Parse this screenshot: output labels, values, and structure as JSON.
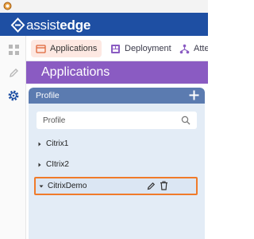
{
  "brand": {
    "name_light": "assist",
    "name_bold": "edge"
  },
  "nav": {
    "items": [
      {
        "label": "Applications",
        "active": true
      },
      {
        "label": "Deployment",
        "active": false
      },
      {
        "label": "Atten",
        "active": false
      }
    ]
  },
  "sidebar": {
    "items": [
      "grid-icon",
      "pencil-icon",
      "gear-icon"
    ],
    "active": "gear-icon"
  },
  "page": {
    "title": "Applications"
  },
  "profile_panel": {
    "title": "Profile",
    "search": {
      "placeholder": "Profile",
      "value": ""
    },
    "items": [
      {
        "label": "Citrix1",
        "expanded": false,
        "selected": false
      },
      {
        "label": "CItrix2",
        "expanded": false,
        "selected": false
      },
      {
        "label": "CitrixDemo",
        "expanded": true,
        "selected": true
      }
    ]
  },
  "colors": {
    "brand_bar": "#1e4fa3",
    "page_header": "#8a5bc2",
    "panel_header": "#5b7bb0",
    "panel_bg": "#e3ecf6",
    "active_nav": "#fde8e2",
    "selection_border": "#f07b2a"
  }
}
